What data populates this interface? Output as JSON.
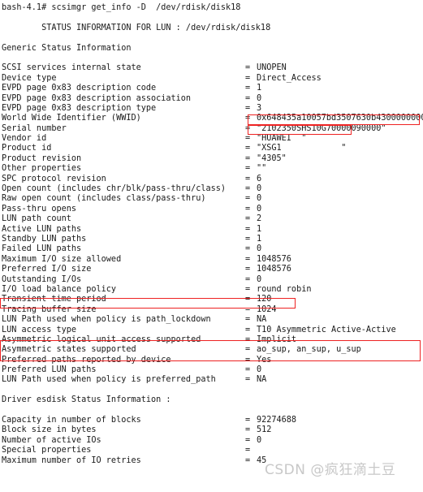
{
  "terminal": {
    "prompt_line": "bash-4.1# scsimgr get_info -D  /dev/rdisk/disk18",
    "title_line": "        STATUS INFORMATION FOR LUN : /dev/rdisk/disk18",
    "section_generic": "Generic Status Information",
    "section_driver": "Driver esdisk Status Information :",
    "watermark": "CSDN @疯狂滴土豆",
    "equals": "=",
    "colors": {
      "background": "#ffffff",
      "text": "#1a1a1a",
      "highlight_box": "#ee2222",
      "watermark": "#c8c8c8"
    }
  },
  "generic_rows": [
    {
      "key": "SCSI services internal state",
      "value": "UNOPEN"
    },
    {
      "key": "Device type",
      "value": "Direct_Access"
    },
    {
      "key": "EVPD page 0x83 description code",
      "value": "1"
    },
    {
      "key": "EVPD page 0x83 description association",
      "value": "0"
    },
    {
      "key": "EVPD page 0x83 description type",
      "value": "3"
    },
    {
      "key": "World Wide Identifier (WWID)",
      "value": "0x648435a10057bd3507630b4300000000"
    },
    {
      "key": "Serial number",
      "value": "\"2102350SHS10G70000090000\""
    },
    {
      "key": "Vendor id",
      "value": "\"HUAWEI  \""
    },
    {
      "key": "Product id",
      "value": "\"XSG1            \""
    },
    {
      "key": "Product revision",
      "value": "\"4305\""
    },
    {
      "key": "Other properties",
      "value": "\"\""
    },
    {
      "key": "SPC protocol revision",
      "value": "6"
    },
    {
      "key": "Open count (includes chr/blk/pass-thru/class)",
      "value": "0"
    },
    {
      "key": "Raw open count (includes class/pass-thru)",
      "value": "0"
    },
    {
      "key": "Pass-thru opens",
      "value": "0"
    },
    {
      "key": "LUN path count",
      "value": "2"
    },
    {
      "key": "Active LUN paths",
      "value": "1"
    },
    {
      "key": "Standby LUN paths",
      "value": "1"
    },
    {
      "key": "Failed LUN paths",
      "value": "0"
    },
    {
      "key": "Maximum I/O size allowed",
      "value": "1048576"
    },
    {
      "key": "Preferred I/O size",
      "value": "1048576"
    },
    {
      "key": "Outstanding I/Os",
      "value": "0"
    },
    {
      "key": "I/O load balance policy",
      "value": "round robin"
    },
    {
      "key": "Transient time period",
      "value": "120"
    },
    {
      "key": "Tracing buffer size",
      "value": "1024"
    },
    {
      "key": "LUN Path used when policy is path_lockdown",
      "value": "NA"
    },
    {
      "key": "LUN access type",
      "value": "T10 Asymmetric Active-Active"
    },
    {
      "key": "Asymmetric logical unit access supported",
      "value": "Implicit"
    },
    {
      "key": "Asymmetric states supported",
      "value": "ao_sup, an_sup, u_sup"
    },
    {
      "key": "Preferred paths reported by device",
      "value": "Yes"
    },
    {
      "key": "Preferred LUN paths",
      "value": "0"
    },
    {
      "key": "LUN Path used when policy is preferred_path",
      "value": "NA"
    }
  ],
  "driver_rows": [
    {
      "key": "Capacity in number of blocks",
      "value": "92274688"
    },
    {
      "key": "Block size in bytes",
      "value": "512"
    },
    {
      "key": "Number of active IOs",
      "value": "0"
    },
    {
      "key": "Special properties",
      "value": ""
    },
    {
      "key": "Maximum number of IO retries",
      "value": "45"
    }
  ]
}
